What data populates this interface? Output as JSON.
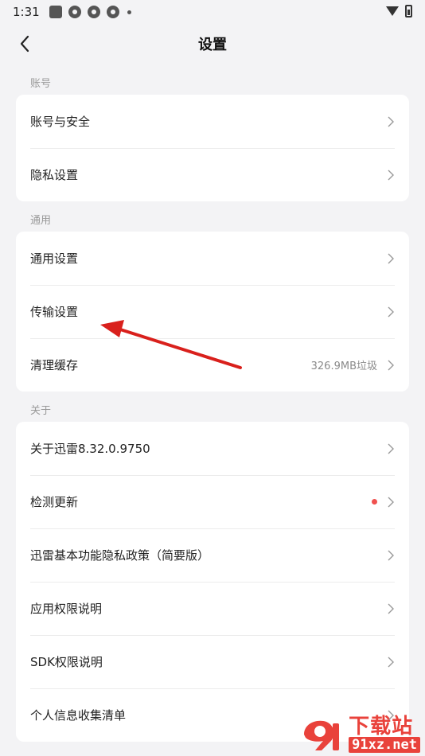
{
  "status_bar": {
    "time": "1:31"
  },
  "header": {
    "title": "设置"
  },
  "sections": [
    {
      "label": "账号",
      "items": [
        {
          "label": "账号与安全",
          "value": ""
        },
        {
          "label": "隐私设置",
          "value": ""
        }
      ]
    },
    {
      "label": "通用",
      "items": [
        {
          "label": "通用设置",
          "value": ""
        },
        {
          "label": "传输设置",
          "value": ""
        },
        {
          "label": "清理缓存",
          "value": "326.9MB垃圾"
        }
      ]
    },
    {
      "label": "关于",
      "items": [
        {
          "label": "关于迅雷8.32.0.9750",
          "value": ""
        },
        {
          "label": "检测更新",
          "value": ""
        },
        {
          "label": "迅雷基本功能隐私政策（简要版）",
          "value": ""
        },
        {
          "label": "应用权限说明",
          "value": ""
        },
        {
          "label": "SDK权限说明",
          "value": ""
        },
        {
          "label": "个人信息收集清单",
          "value": ""
        }
      ]
    }
  ],
  "watermark": {
    "title": "下载站",
    "site": "91xz.net"
  },
  "colors": {
    "accent_red": "#f0514f",
    "arrow_red": "#d9201c",
    "watermark_red": "#e9423b"
  }
}
